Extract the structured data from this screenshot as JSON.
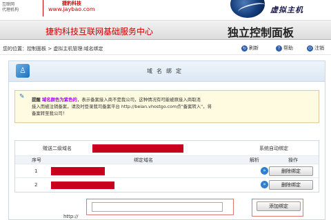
{
  "header": {
    "brand_left_line1": "互联网",
    "brand_left_line2": "代理机构",
    "logo_text": "捷豹科技",
    "site_url": "www.jaybao.com",
    "brand_right": "虚拟主机"
  },
  "banner": {
    "title": "捷豹科技互联网基础服务中心",
    "subtitle": "独立控制面板"
  },
  "breadcrumb": {
    "prefix": "您的位置：",
    "items": [
      "控制面板",
      "虚拟主机管理:域名绑定"
    ],
    "separator": " > "
  },
  "toolbar": {
    "refresh_label": "刷新",
    "help_label": "帮助",
    "logout_label": "注销"
  },
  "panel": {
    "title": "域名绑定"
  },
  "notice": {
    "label": "提醒",
    "highlight": "域名颜色为紫色的",
    "line1_rest": "，表示备案接入商不是我公司，这种情况有可能被原接入商取消",
    "line2": "接入而被注销备案，请及时登录我司备案平台 http://beian.vhostgo.com点\"备案转入\"，将",
    "line3": "备案转至我公司！"
  },
  "table": {
    "gift_label": "赠送二级域名",
    "auto_bind": "系统自动绑定",
    "headers": {
      "index": "序号",
      "domain": "绑定域名",
      "resolve": "解析",
      "action": "操作"
    },
    "rows": [
      {
        "index": "1",
        "action_label": "删除绑定"
      },
      {
        "index": "2",
        "action_label": "删除绑定"
      }
    ]
  },
  "add": {
    "prefix": "http://",
    "input_value": "",
    "button_label": "添加绑定"
  },
  "colors": {
    "accent_red": "#c00",
    "redaction": "#c8001e",
    "notice_bg": "#fffbe0",
    "highlight_purple": "#a0f"
  }
}
